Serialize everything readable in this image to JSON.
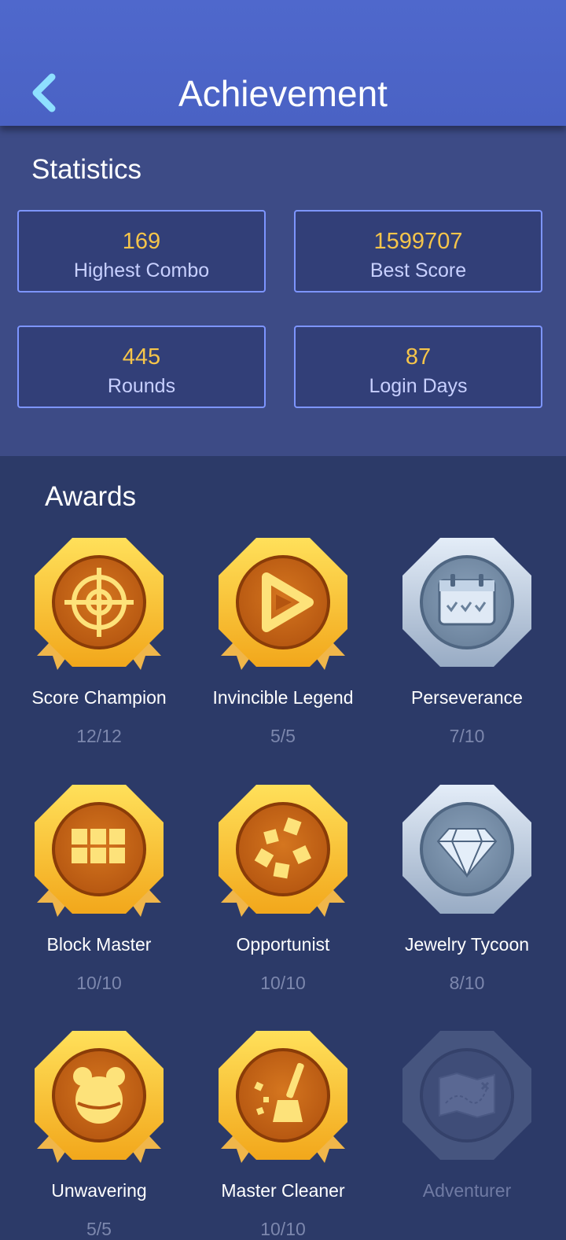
{
  "header": {
    "title": "Achievement"
  },
  "statistics": {
    "title": "Statistics",
    "cards": [
      {
        "value": "169",
        "label": "Highest Combo"
      },
      {
        "value": "1599707",
        "label": "Best Score"
      },
      {
        "value": "445",
        "label": "Rounds"
      },
      {
        "value": "87",
        "label": "Login Days"
      }
    ]
  },
  "awards": {
    "title": "Awards",
    "items": [
      {
        "name": "Score Champion",
        "progress": "12/12",
        "tier": "gold",
        "icon": "target-icon"
      },
      {
        "name": "Invincible Legend",
        "progress": "5/5",
        "tier": "gold",
        "icon": "penrose-triangle-icon"
      },
      {
        "name": "Perseverance",
        "progress": "7/10",
        "tier": "silver",
        "icon": "calendar-icon"
      },
      {
        "name": "Block Master",
        "progress": "10/10",
        "tier": "gold",
        "icon": "blocks-icon"
      },
      {
        "name": "Opportunist",
        "progress": "10/10",
        "tier": "gold",
        "icon": "scattered-cubes-icon"
      },
      {
        "name": "Jewelry Tycoon",
        "progress": "8/10",
        "tier": "silver",
        "icon": "diamond-icon"
      },
      {
        "name": "Unwavering",
        "progress": "5/5",
        "tier": "gold",
        "icon": "mouse-head-icon"
      },
      {
        "name": "Master Cleaner",
        "progress": "10/10",
        "tier": "gold",
        "icon": "broom-icon"
      },
      {
        "name": "Adventurer",
        "progress": "",
        "tier": "locked",
        "icon": "map-icon"
      }
    ]
  },
  "colors": {
    "header": "#4f68cc",
    "stat_value": "#f6c54a",
    "card_border": "#7d95ff",
    "gold": "#f7c52c",
    "silver": "#b7c7dc"
  }
}
